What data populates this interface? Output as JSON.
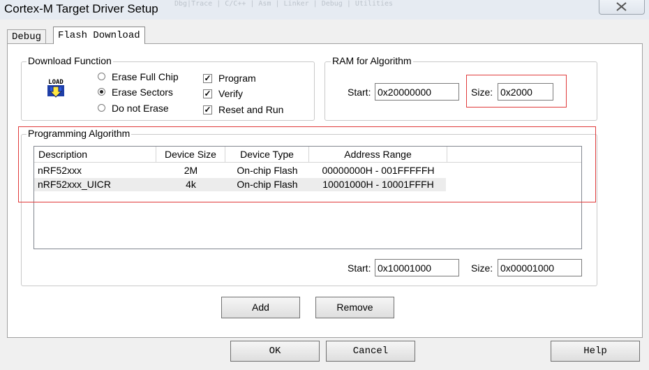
{
  "window": {
    "title": "Cortex-M Target Driver Setup",
    "ghost_tabs": "Dbg|Trace | C/C++ | Asm | Linker | Debug | Utilities"
  },
  "tabs": [
    {
      "label": "Debug"
    },
    {
      "label": "Flash Download"
    }
  ],
  "download_function": {
    "legend": "Download Function",
    "icon": "load-icon",
    "icon_text": "LOAD",
    "radios": [
      {
        "label": "Erase Full Chip",
        "selected": false
      },
      {
        "label": "Erase Sectors",
        "selected": true
      },
      {
        "label": "Do not Erase",
        "selected": false
      }
    ],
    "checks": [
      {
        "label": "Program",
        "checked": true
      },
      {
        "label": "Verify",
        "checked": true
      },
      {
        "label": "Reset and Run",
        "checked": true
      }
    ]
  },
  "ram": {
    "legend": "RAM for Algorithm",
    "start_label": "Start:",
    "start_value": "0x20000000",
    "size_label": "Size:",
    "size_value": "0x2000"
  },
  "programming_algorithm": {
    "legend": "Programming Algorithm",
    "columns": [
      "Description",
      "Device Size",
      "Device Type",
      "Address Range"
    ],
    "rows": [
      {
        "description": "nRF52xxx",
        "size": "2M",
        "type": "On-chip Flash",
        "range": "00000000H - 001FFFFFH"
      },
      {
        "description": "nRF52xxx_UICR",
        "size": "4k",
        "type": "On-chip Flash",
        "range": "10001000H - 10001FFFH"
      }
    ],
    "start_label": "Start:",
    "start_value": "0x10001000",
    "size_label": "Size:",
    "size_value": "0x00001000",
    "add_label": "Add",
    "remove_label": "Remove"
  },
  "footer": {
    "ok_label": "OK",
    "cancel_label": "Cancel",
    "help_label": "Help"
  },
  "colors": {
    "highlight": "#e03a3a",
    "panel": "#ffffff",
    "window": "#f0f0f0"
  }
}
